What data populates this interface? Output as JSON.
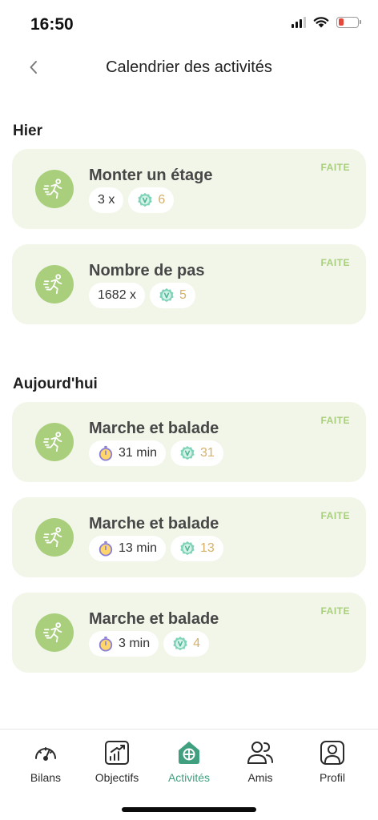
{
  "status_bar": {
    "time": "16:50",
    "battery_color": "#e5483a"
  },
  "header": {
    "title": "Calendrier des activités",
    "back_icon": "chevron-left-icon"
  },
  "colors": {
    "accent_green": "#a9cf7d",
    "card_bg": "#f1f6e9",
    "point_value": "#d5b06a",
    "active_tab": "#3f9f7f",
    "timer_purple": "#8b7fd6",
    "badge_teal": "#7fd3b8"
  },
  "sections": [
    {
      "title": "Hier",
      "cards": [
        {
          "title": "Monter un étage",
          "status": "FAITE",
          "icon": "running-man-icon",
          "amount": "3 x",
          "amount_icon": "",
          "points": "6",
          "points_icon": "v-badge-icon"
        },
        {
          "title": "Nombre de pas",
          "status": "FAITE",
          "icon": "running-man-icon",
          "amount": "1682 x",
          "amount_icon": "",
          "points": "5",
          "points_icon": "v-badge-icon"
        }
      ]
    },
    {
      "title": "Aujourd'hui",
      "cards": [
        {
          "title": "Marche et balade",
          "status": "FAITE",
          "icon": "running-man-icon",
          "amount": "31 min",
          "amount_icon": "stopwatch-icon",
          "points": "31",
          "points_icon": "v-badge-icon"
        },
        {
          "title": "Marche et balade",
          "status": "FAITE",
          "icon": "running-man-icon",
          "amount": "13 min",
          "amount_icon": "stopwatch-icon",
          "points": "13",
          "points_icon": "v-badge-icon"
        },
        {
          "title": "Marche et balade",
          "status": "FAITE",
          "icon": "running-man-icon",
          "amount": "3 min",
          "amount_icon": "stopwatch-icon",
          "points": "4",
          "points_icon": "v-badge-icon"
        }
      ]
    }
  ],
  "tabs": [
    {
      "label": "Bilans",
      "icon": "gauge-icon",
      "active": false
    },
    {
      "label": "Objectifs",
      "icon": "chart-up-icon",
      "active": false
    },
    {
      "label": "Activités",
      "icon": "activity-house-icon",
      "active": true
    },
    {
      "label": "Amis",
      "icon": "friends-icon",
      "active": false
    },
    {
      "label": "Profil",
      "icon": "profile-icon",
      "active": false
    }
  ]
}
